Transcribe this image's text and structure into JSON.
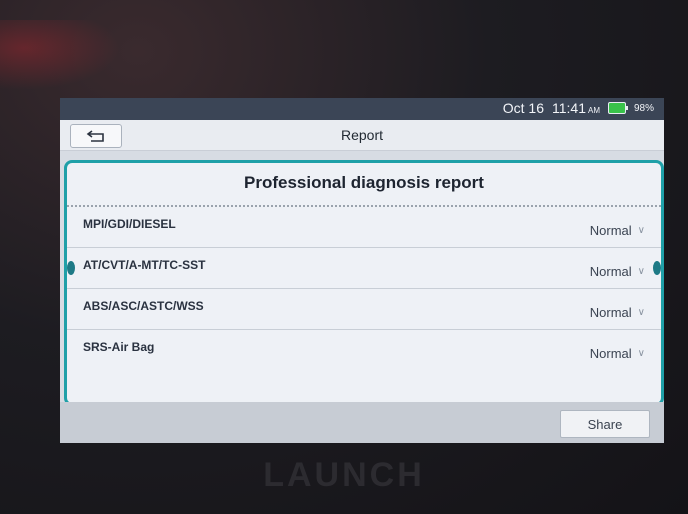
{
  "status_bar": {
    "date": "Oct 16",
    "time": "11:41",
    "ampm": "AM",
    "battery_percent": "98%",
    "battery_color": "#39c24a"
  },
  "header": {
    "title": "Report"
  },
  "report": {
    "title": "Professional diagnosis report",
    "rows": [
      {
        "label": "MPI/GDI/DIESEL",
        "status": "Normal"
      },
      {
        "label": "AT/CVT/A-MT/TC-SST",
        "status": "Normal"
      },
      {
        "label": "ABS/ASC/ASTC/WSS",
        "status": "Normal"
      },
      {
        "label": "SRS-Air Bag",
        "status": "Normal"
      }
    ]
  },
  "footer": {
    "share_label": "Share"
  },
  "device": {
    "brand": "LAUNCH"
  },
  "colors": {
    "accent": "#1fa0a8",
    "status_bar_bg": "#3b4556"
  }
}
